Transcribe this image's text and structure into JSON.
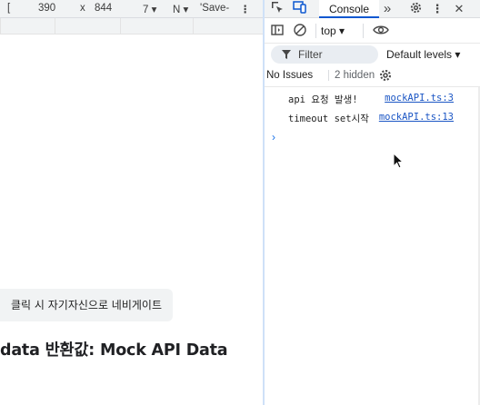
{
  "device_toolbar": {
    "dimensions_label": "[",
    "width": "390",
    "times": "x",
    "height": "844",
    "zoom": "7",
    "throttle": "N",
    "save_data": "'Save-",
    "more": "⋮"
  },
  "page": {
    "navigate_button": "클릭 시 자기자신으로 네비게이트",
    "result_text": "data 반환값: Mock API Data"
  },
  "devtools": {
    "tabs": {
      "active": "Console",
      "more": "»"
    },
    "toolbar": {
      "context": "top"
    },
    "filter": {
      "placeholder": "Filter",
      "levels": "Default levels"
    },
    "issues": {
      "label": "No Issues",
      "hidden": "2 hidden"
    },
    "logs": [
      {
        "message": "api 요청 발생!",
        "source": "mockAPI.ts:3"
      },
      {
        "message": "timeout set시작",
        "source": "mockAPI.ts:13"
      }
    ],
    "prompt": "›"
  },
  "colors": {
    "accent": "#0b57d0",
    "link": "#1a55c4",
    "toolbar_bg": "#f1f3f4",
    "pane_divider": "#cfe1f8"
  },
  "icons": [
    "inspect-icon",
    "device-toggle-icon",
    "more-tabs-icon",
    "settings-icon",
    "more-options-icon",
    "sidebar-icon",
    "clear-console-icon",
    "eye-icon",
    "filter-icon",
    "gear-icon",
    "mouse-cursor-icon"
  ]
}
